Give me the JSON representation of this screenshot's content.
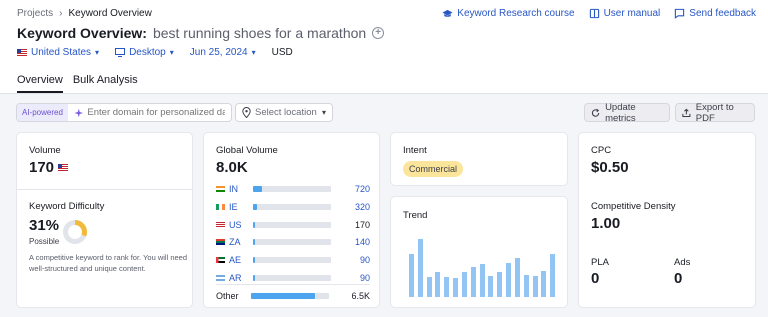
{
  "breadcrumb": {
    "root": "Projects",
    "current": "Keyword Overview"
  },
  "top_links": {
    "course": "Keyword Research course",
    "manual": "User manual",
    "feedback": "Send feedback"
  },
  "title": {
    "label": "Keyword Overview:",
    "keyword": "best running shoes for a marathon"
  },
  "filters": {
    "country": "United States",
    "device": "Desktop",
    "date": "Jun 25, 2024",
    "currency": "USD"
  },
  "tabs": [
    "Overview",
    "Bulk Analysis"
  ],
  "toolbar": {
    "ai_badge": "AI-powered",
    "domain_placeholder": "Enter domain for personalized data",
    "location_placeholder": "Select location",
    "update_label": "Update metrics",
    "export_label": "Export to PDF"
  },
  "volume": {
    "label": "Volume",
    "value": "170"
  },
  "difficulty": {
    "label": "Keyword Difficulty",
    "value": "31%",
    "level": "Possible",
    "percent": 31,
    "description": "A competitive keyword to rank for. You will need well-structured and unique content."
  },
  "global_volume": {
    "label": "Global Volume",
    "value": "8.0K",
    "countries": [
      {
        "code": "IN",
        "value": "720",
        "share": 0.11
      },
      {
        "code": "IE",
        "value": "320",
        "share": 0.05
      },
      {
        "code": "US",
        "value": "170",
        "share": 0.03
      },
      {
        "code": "ZA",
        "value": "140",
        "share": 0.02
      },
      {
        "code": "AE",
        "value": "90",
        "share": 0.015
      },
      {
        "code": "AR",
        "value": "90",
        "share": 0.015
      }
    ],
    "other": {
      "label": "Other",
      "value": "6.5K",
      "share": 0.82
    }
  },
  "intent": {
    "label": "Intent",
    "value": "Commercial"
  },
  "trend": {
    "label": "Trend",
    "values": [
      0.62,
      0.83,
      0.28,
      0.35,
      0.29,
      0.27,
      0.36,
      0.43,
      0.47,
      0.3,
      0.36,
      0.48,
      0.56,
      0.31,
      0.3,
      0.37,
      0.61
    ]
  },
  "cpc": {
    "label": "CPC",
    "value": "$0.50"
  },
  "competitive_density": {
    "label": "Competitive Density",
    "value": "1.00"
  },
  "pla": {
    "label": "PLA",
    "value": "0"
  },
  "ads": {
    "label": "Ads",
    "value": "0"
  },
  "colors": {
    "accent": "#2756c5",
    "bar": "#4da4ee",
    "intent": "#fbe59a",
    "kd_ring": "#f1ba3a"
  }
}
